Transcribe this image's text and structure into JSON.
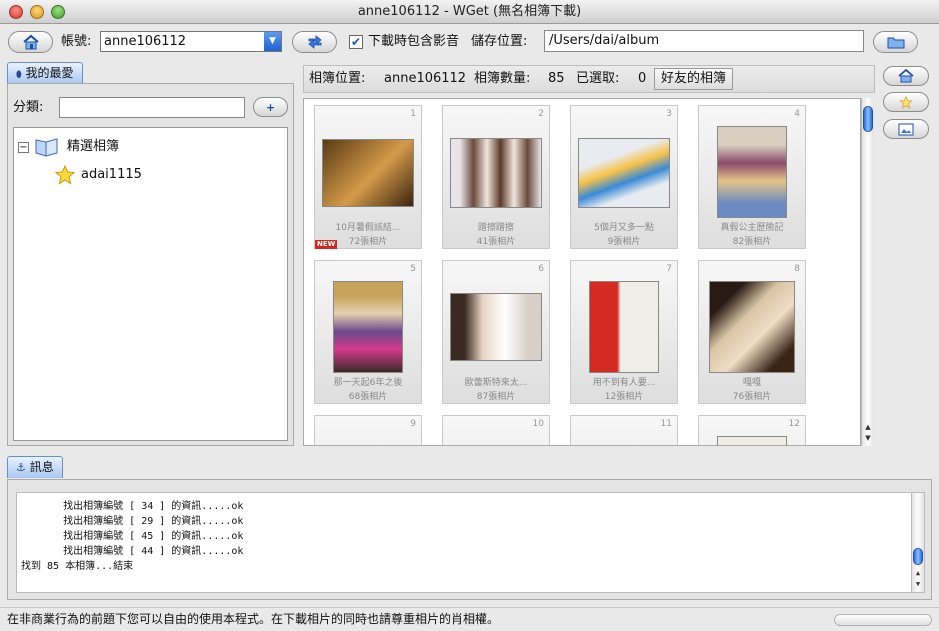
{
  "window": {
    "title": "anne106112 - WGet (無名相簿下載)"
  },
  "toolbar": {
    "account_label": "帳號:",
    "account_value": "anne106112",
    "include_video_label": "下載時包含影音",
    "include_video_checked": true,
    "save_location_label": "儲存位置:",
    "save_path": "/Users/dai/album"
  },
  "favorites": {
    "tab_label": "我的最愛",
    "category_label": "分類:",
    "category_value": "",
    "tree": [
      {
        "label": "精選相簿",
        "expand": "−",
        "icon": "album-book-icon"
      },
      {
        "label": "adai1115",
        "icon": "star-icon"
      }
    ]
  },
  "album_info": {
    "location_label": "相簿位置:",
    "location_value": "anne106112",
    "count_label": "相簿數量:",
    "count_value": "85",
    "selected_label": "已選取:",
    "selected_value": "0",
    "friends_button": "好友的相簿"
  },
  "albums": [
    {
      "num": "1",
      "title": "10月暑假該結...",
      "photos": "72張相片",
      "is_new": true,
      "new_label": "NEW",
      "thumb_colors": [
        "#5a3a14",
        "#d49a4a"
      ]
    },
    {
      "num": "2",
      "title": "蹭擦蹭擦",
      "photos": "41張相片",
      "is_new": false,
      "thumb_colors": [
        "#e9e4e8",
        "#6a4a3a"
      ]
    },
    {
      "num": "3",
      "title": "5個月又多一點",
      "photos": "9張相片",
      "is_new": false,
      "thumb_colors": [
        "#e8ecf0",
        "#3a8ad6"
      ]
    },
    {
      "num": "4",
      "title": "真假公主歷險記",
      "photos": "82張相片",
      "is_new": false,
      "thumb_colors": [
        "#d8cfc0",
        "#8a4a6a"
      ]
    },
    {
      "num": "5",
      "title": "那一天起6年之後",
      "photos": "68張相片",
      "is_new": false,
      "thumb_colors": [
        "#c7a45a",
        "#6a4a8a"
      ]
    },
    {
      "num": "6",
      "title": "歐蕾斯特來太...",
      "photos": "87張相片",
      "is_new": false,
      "thumb_colors": [
        "#ffffff",
        "#3a2a22"
      ]
    },
    {
      "num": "7",
      "title": "用不到有人要...",
      "photos": "12張相片",
      "is_new": false,
      "thumb_colors": [
        "#f0eee8",
        "#d42a22"
      ]
    },
    {
      "num": "8",
      "title": "嘎嘎",
      "photos": "76張相片",
      "is_new": false,
      "thumb_colors": [
        "#d8c4a4",
        "#2a1a14"
      ]
    },
    {
      "num": "9"
    },
    {
      "num": "10"
    },
    {
      "num": "11"
    },
    {
      "num": "12"
    }
  ],
  "messages": {
    "tab_label": "訊息",
    "lines": [
      "       找出相簿編號 [ 34 ] 的資訊.....ok",
      "       找出相簿編號 [ 29 ] 的資訊.....ok",
      "       找出相簿編號 [ 45 ] 的資訊.....ok",
      "       找出相簿編號 [ 44 ] 的資訊.....ok",
      "找到 85 本相簿...結束"
    ]
  },
  "status": {
    "text": "在非商業行為的前題下您可以自由的使用本程式。在下載相片的同時也請尊重相片的肖相權。"
  },
  "colors": {
    "accent": "#1f5fd1",
    "new_badge": "#d6261c"
  },
  "icons": {
    "home": "home-icon",
    "swap": "swap-arrows-icon",
    "folder": "folder-icon",
    "add": "plus-icon",
    "anchor": "anchor-icon",
    "star": "star-icon",
    "photo": "photo-icon"
  }
}
